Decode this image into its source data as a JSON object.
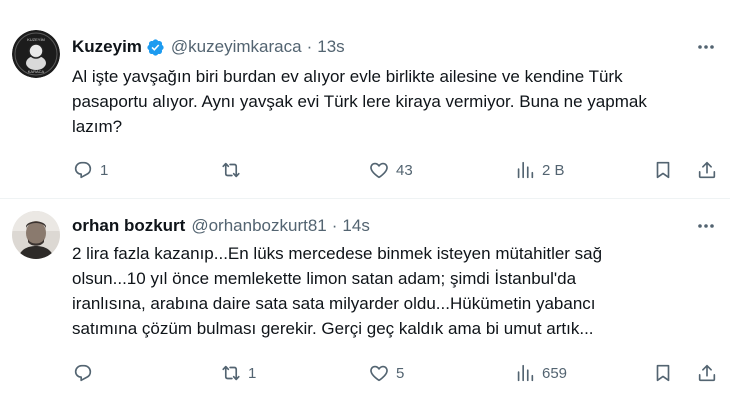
{
  "tweets": [
    {
      "display_name": "Kuzeyim",
      "handle": "@kuzeyimkaraca",
      "separator": "·",
      "time": "13s",
      "verified": true,
      "text_lines": [
        "Al işte yavşağın biri burdan ev alıyor evle birlikte ailesine ve kendine Türk",
        "pasaportu alıyor. Aynı yavşak evi Türk lere kiraya vermiyor. Buna ne yapmak",
        "lazım?"
      ],
      "replies": "1",
      "reposts": "",
      "likes": "43",
      "views": "2 B",
      "avatar_lines": [
        "KUZEYİM",
        "KARACA"
      ]
    },
    {
      "display_name": "orhan bozkurt",
      "handle": "@orhanbozkurt81",
      "separator": "·",
      "time": "14s",
      "verified": false,
      "text_lines": [
        "2 lira fazla kazanıp...En lüks mercedese binmek isteyen mütahitler sağ",
        "olsun...10 yıl önce memlekette limon satan adam; şimdi İstanbul'da",
        "iranlısına, arabına daire sata sata milyarder oldu...Hükümetin yabancı",
        "satımına çözüm bulması gerekir. Gerçi geç kaldık ama bi umut artık..."
      ],
      "replies": "",
      "reposts": "1",
      "likes": "5",
      "views": "659"
    }
  ],
  "colors": {
    "text": "#0f1419",
    "secondary": "#536471",
    "verified_blue": "#1d9bf0",
    "divider": "#eff3f4"
  }
}
